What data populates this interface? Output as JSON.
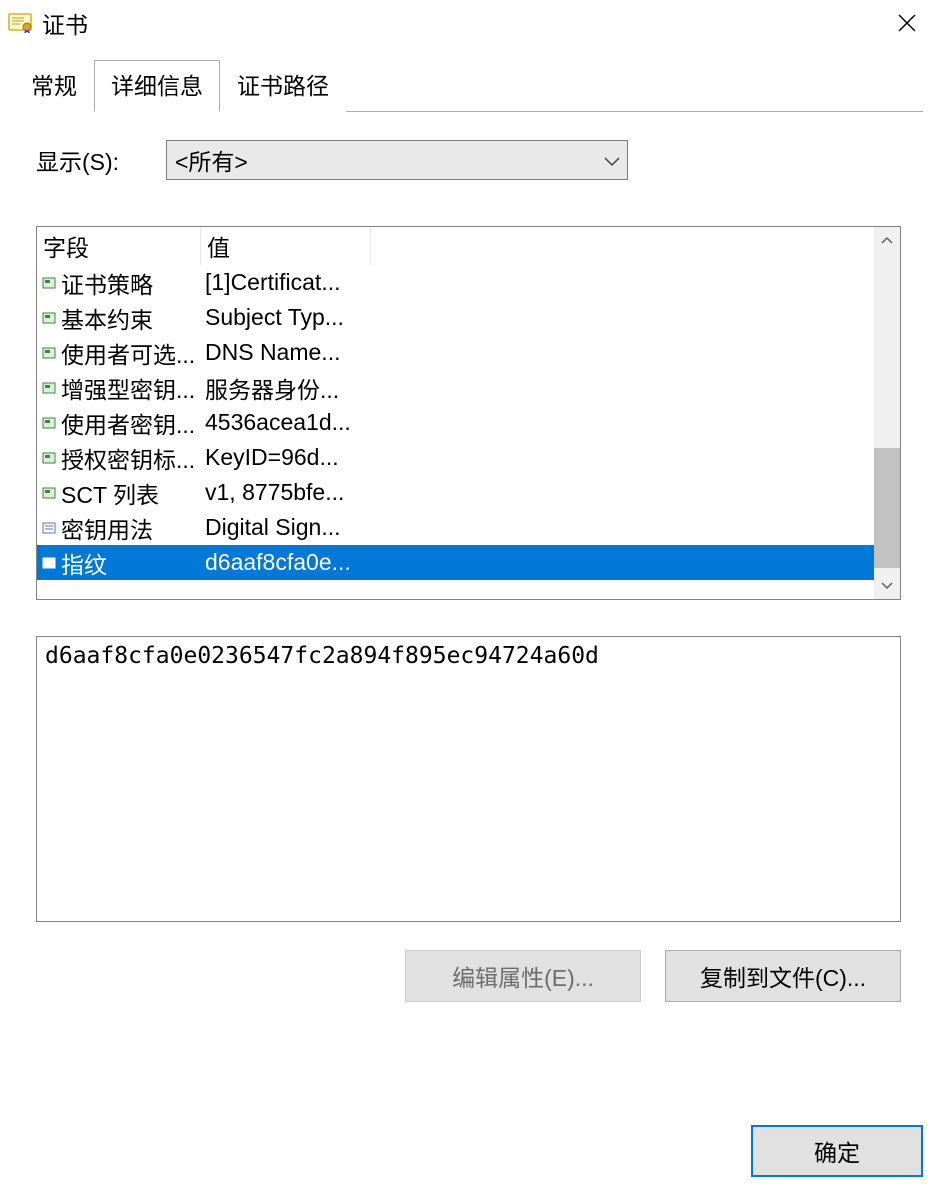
{
  "window": {
    "title": "证书"
  },
  "tabs": {
    "general": "常规",
    "details": "详细信息",
    "path": "证书路径",
    "active_index": 1
  },
  "show": {
    "label": "显示(S):",
    "selected": "<所有>"
  },
  "listview": {
    "headers": {
      "field": "字段",
      "value": "值"
    },
    "rows": [
      {
        "icon": "ext",
        "field": "证书策略",
        "value": "[1]Certificat..."
      },
      {
        "icon": "ext",
        "field": "基本约束",
        "value": "Subject Typ..."
      },
      {
        "icon": "ext",
        "field": "使用者可选...",
        "value": "DNS Name..."
      },
      {
        "icon": "ext",
        "field": "增强型密钥...",
        "value": "服务器身份..."
      },
      {
        "icon": "ext",
        "field": "使用者密钥...",
        "value": "4536acea1d..."
      },
      {
        "icon": "ext",
        "field": "授权密钥标...",
        "value": "KeyID=96d..."
      },
      {
        "icon": "ext",
        "field": "SCT 列表",
        "value": "v1, 8775bfe..."
      },
      {
        "icon": "prop",
        "field": "密钥用法",
        "value": "Digital Sign..."
      },
      {
        "icon": "prop",
        "field": "指纹",
        "value": "d6aaf8cfa0e...",
        "selected": true
      }
    ]
  },
  "detail": {
    "value": "d6aaf8cfa0e0236547fc2a894f895ec94724a60d"
  },
  "buttons": {
    "edit": "编辑属性(E)...",
    "copy": "复制到文件(C)...",
    "ok": "确定"
  }
}
